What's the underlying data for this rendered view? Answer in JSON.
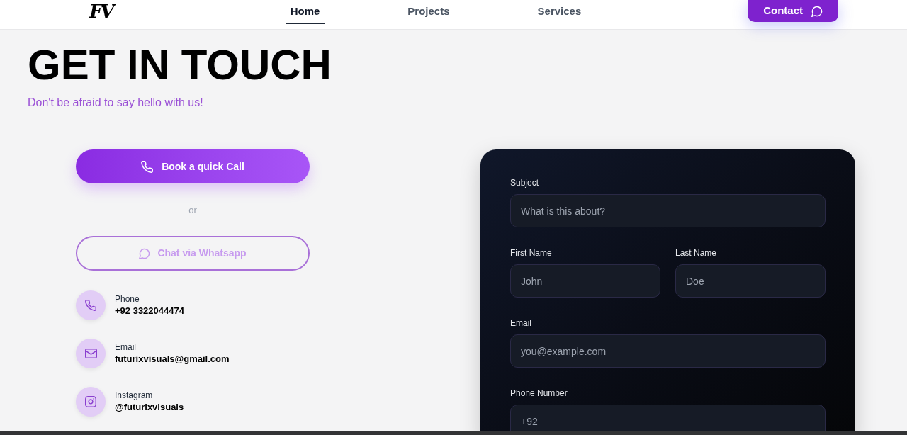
{
  "nav": {
    "logo": "FV",
    "links": [
      {
        "label": "Home",
        "selected": true
      },
      {
        "label": "Projects",
        "selected": false
      },
      {
        "label": "Services",
        "selected": false
      }
    ],
    "contact_button": "Contact"
  },
  "hero": {
    "title": "GET IN TOUCH",
    "subtitle": "Don't be afraid to say hello with us!"
  },
  "actions": {
    "primary_button": "Book a quick Call",
    "separator": "or",
    "secondary_button": "Chat via Whatsapp"
  },
  "contact_items": [
    {
      "kind": "phone",
      "label": "Phone",
      "value": "+92 3322044474"
    },
    {
      "kind": "email",
      "label": "Email",
      "value": "futurixvisuals@gmail.com"
    },
    {
      "kind": "instagram",
      "label": "Instagram",
      "value": "@futurixvisuals"
    }
  ],
  "form": {
    "rows": [
      {
        "fields": [
          {
            "label": "Subject",
            "placeholder": "What is this about?"
          }
        ]
      },
      {
        "fields": [
          {
            "label": "First Name",
            "placeholder": "John"
          },
          {
            "label": "Last Name",
            "placeholder": "Doe"
          }
        ]
      },
      {
        "fields": [
          {
            "label": "Email",
            "placeholder": "you@example.com"
          }
        ]
      },
      {
        "fields": [
          {
            "label": "Phone Number",
            "placeholder": "+92"
          }
        ]
      }
    ]
  }
}
